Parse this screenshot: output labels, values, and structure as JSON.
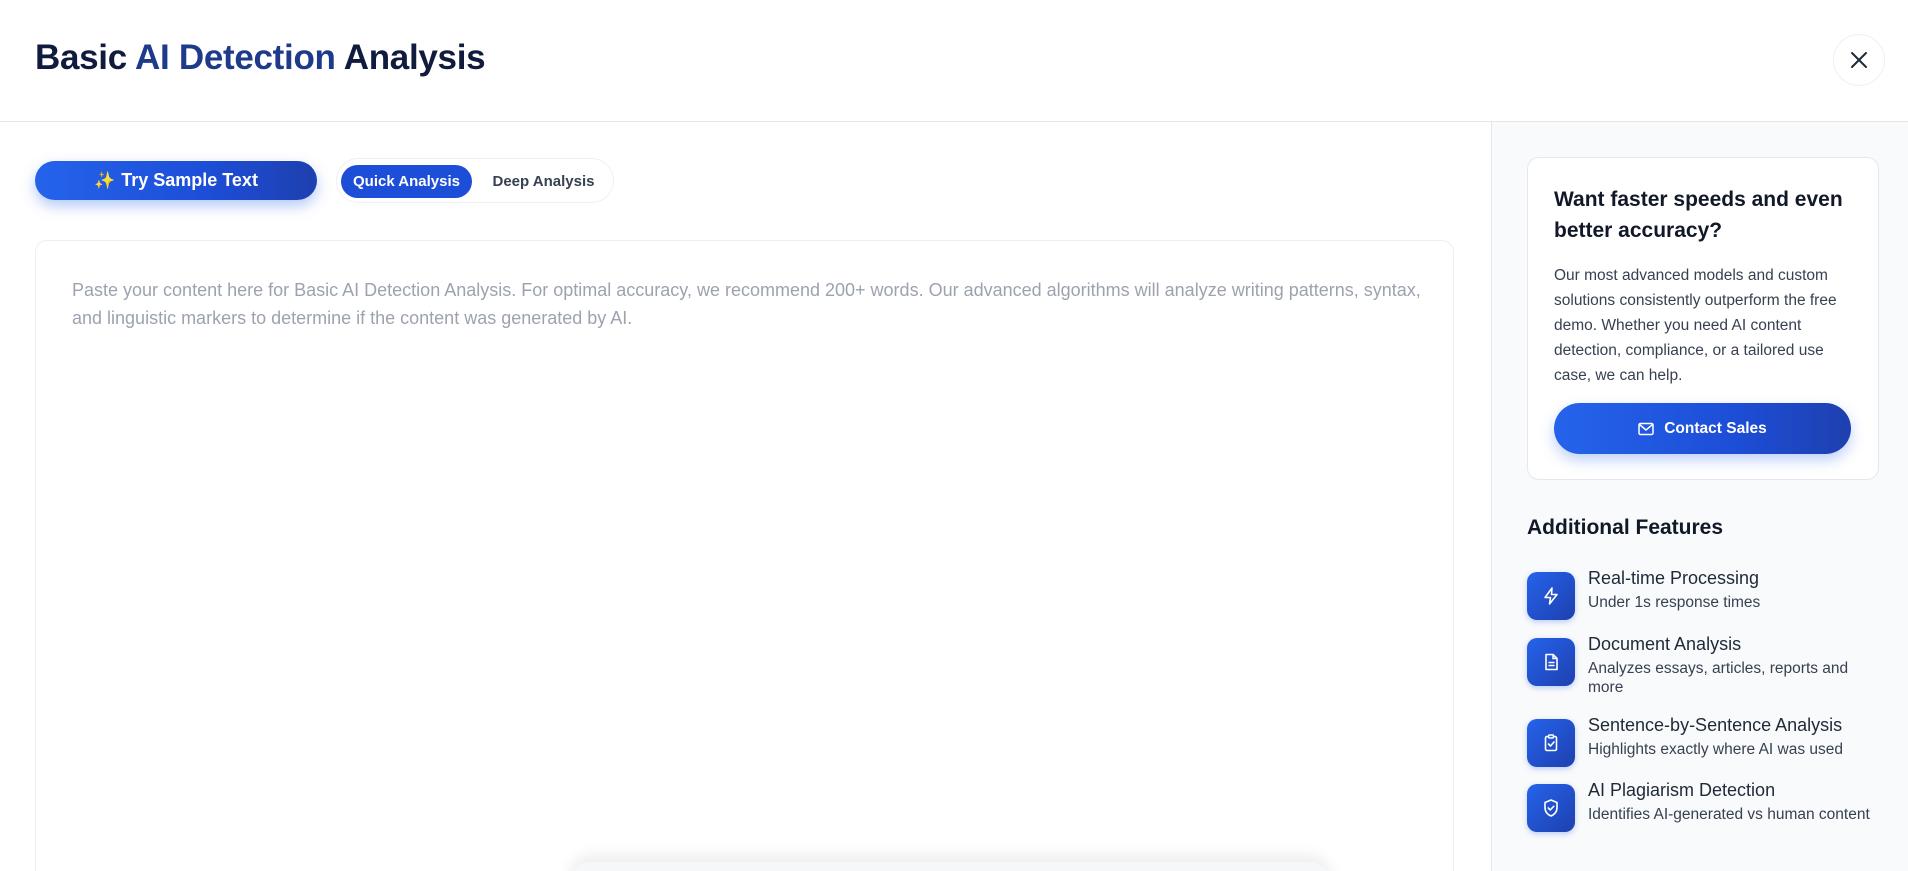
{
  "header": {
    "title_part1": "Basic ",
    "title_part2": "AI Detection",
    "title_part3": " Analysis"
  },
  "toolbar": {
    "sample_icon": "✨",
    "sample_label": "Try Sample Text",
    "modes": [
      {
        "label": "Quick Analysis",
        "selected": true
      },
      {
        "label": "Deep Analysis",
        "selected": false
      }
    ]
  },
  "editor": {
    "placeholder": "Paste your content here for Basic AI Detection Analysis. For optimal accuracy, we recommend 200+ words. Our advanced algorithms will analyze writing patterns, syntax, and linguistic markers to determine if the content was generated by AI."
  },
  "promo": {
    "title": "Want faster speeds and even better accuracy?",
    "text": "Our most advanced models and custom solutions consistently outperform the free demo. Whether you need AI content detection, compliance, or a tailored use case, we can help.",
    "button_label": "Contact Sales",
    "button_icon": "mail-icon"
  },
  "features": {
    "title": "Additional Features",
    "items": [
      {
        "icon": "lightning-icon",
        "name": "Real-time Processing",
        "desc": "Under 1s response times"
      },
      {
        "icon": "document-icon",
        "name": "Document Analysis",
        "desc": "Analyzes essays, articles, reports and more"
      },
      {
        "icon": "clipboard-check-icon",
        "name": "Sentence-by-Sentence Analysis",
        "desc": "Highlights exactly where AI was used"
      },
      {
        "icon": "shield-check-icon",
        "name": "AI Plagiarism Detection",
        "desc": "Identifies AI-generated vs human content"
      }
    ]
  },
  "colors": {
    "accent": "#1d4ed8",
    "title_dark": "#111b3d",
    "title_accent": "#1e3a8a",
    "placeholder": "#9ca3af"
  }
}
